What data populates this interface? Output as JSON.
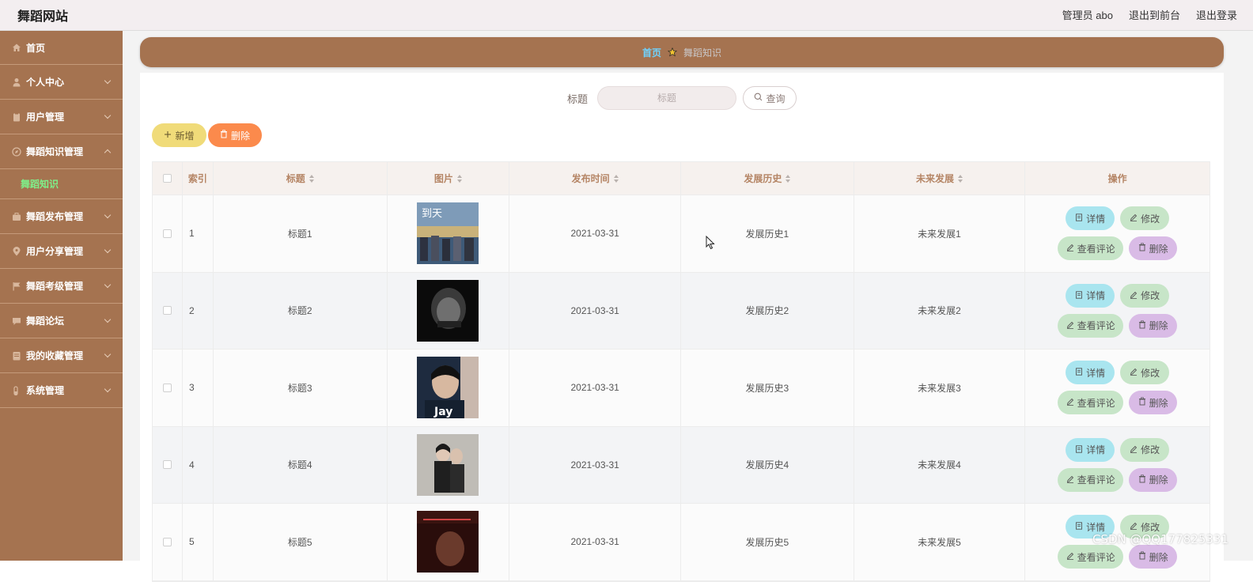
{
  "app": {
    "title": "舞蹈网站"
  },
  "header": {
    "user": "管理员 abo",
    "front": "退出到前台",
    "logout": "退出登录"
  },
  "sidebar": {
    "items": [
      {
        "label": "首页",
        "icon": "home-icon"
      },
      {
        "label": "个人中心",
        "icon": "user-icon"
      },
      {
        "label": "用户管理",
        "icon": "clipboard-icon"
      },
      {
        "label": "舞蹈知识管理",
        "icon": "compass-icon",
        "expanded": true,
        "sub": "舞蹈知识"
      },
      {
        "label": "舞蹈发布管理",
        "icon": "briefcase-icon"
      },
      {
        "label": "用户分享管理",
        "icon": "location-icon"
      },
      {
        "label": "舞蹈考级管理",
        "icon": "flag-icon"
      },
      {
        "label": "舞蹈论坛",
        "icon": "chat-icon"
      },
      {
        "label": "我的收藏管理",
        "icon": "list-icon"
      },
      {
        "label": "系统管理",
        "icon": "lock-icon"
      }
    ]
  },
  "breadcrumb": {
    "home": "首页",
    "current": "舞蹈知识"
  },
  "search": {
    "label": "标题",
    "placeholder": "标题",
    "button": "查询"
  },
  "actions": {
    "add": "新增",
    "delete": "删除"
  },
  "table": {
    "columns": [
      "索引",
      "标题",
      "图片",
      "发布时间",
      "发展历史",
      "未来发展",
      "操作"
    ],
    "rows": [
      {
        "index": "1",
        "title": "标题1",
        "date": "2021-03-31",
        "history": "发展历史1",
        "future": "未来发展1"
      },
      {
        "index": "2",
        "title": "标题2",
        "date": "2021-03-31",
        "history": "发展历史2",
        "future": "未来发展2"
      },
      {
        "index": "3",
        "title": "标题3",
        "date": "2021-03-31",
        "history": "发展历史3",
        "future": "未来发展3"
      },
      {
        "index": "4",
        "title": "标题4",
        "date": "2021-03-31",
        "history": "发展历史4",
        "future": "未来发展4"
      },
      {
        "index": "5",
        "title": "标题5",
        "date": "2021-03-31",
        "history": "发展历史5",
        "future": "未来发展5"
      }
    ],
    "ops": {
      "detail": "详情",
      "edit": "修改",
      "comment": "查看评论",
      "remove": "删除"
    }
  },
  "watermark": "CSDN @QQ177825331",
  "colors": {
    "sidebar": "#a57350",
    "accent_green": "#7ef08a",
    "breadcrumb_home": "#6fd3ff"
  }
}
